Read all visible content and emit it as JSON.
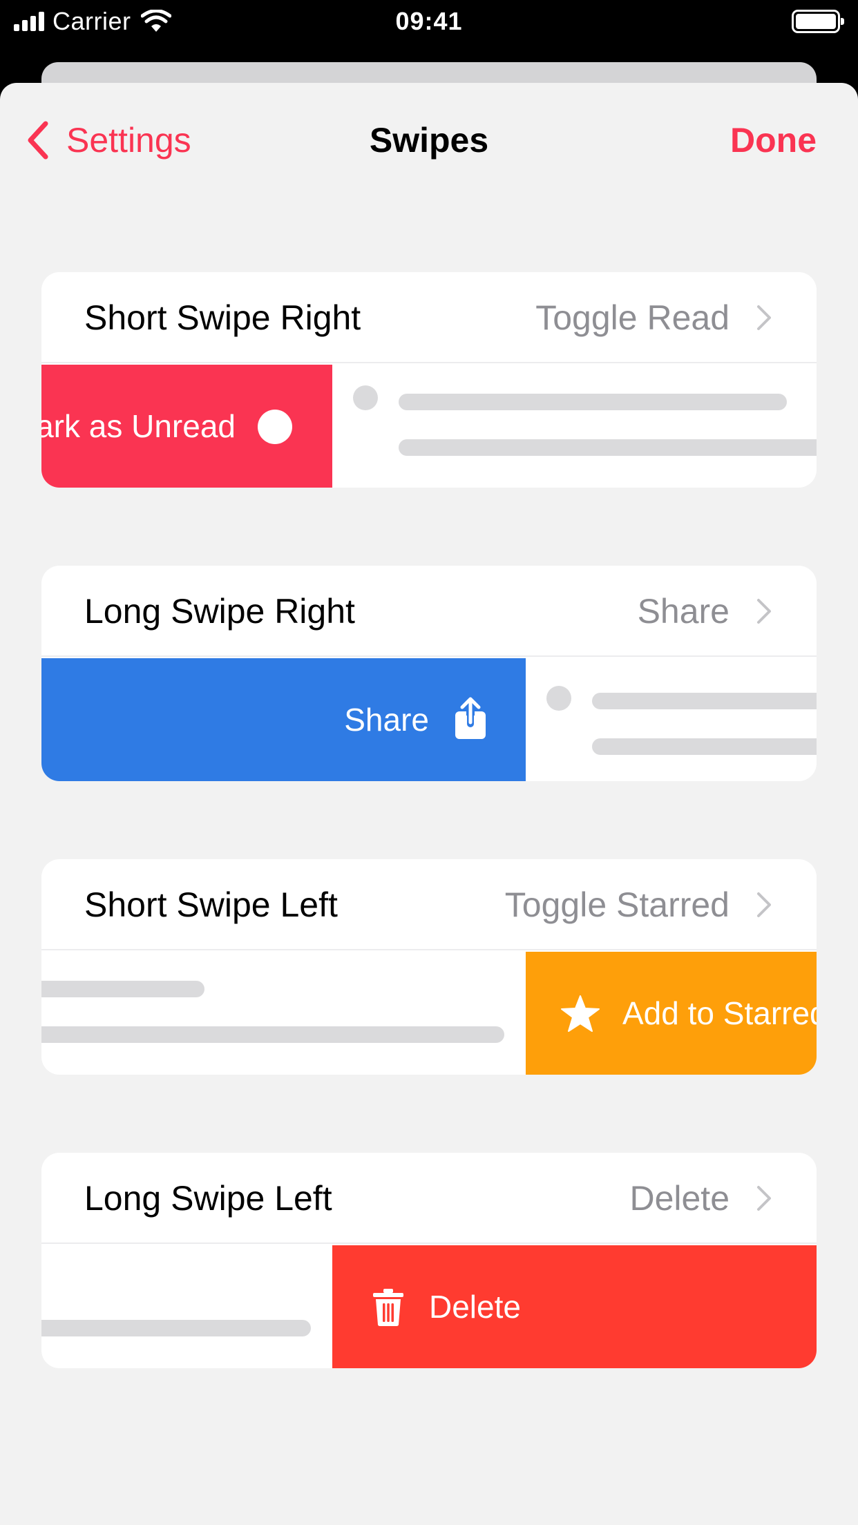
{
  "status_bar": {
    "carrier": "Carrier",
    "time": "09:41",
    "icons": [
      "signal-icon",
      "wifi-icon",
      "battery-icon"
    ]
  },
  "nav": {
    "back_label": "Settings",
    "title": "Swipes",
    "done_label": "Done",
    "icons": [
      "chevron-left-icon"
    ]
  },
  "sections": [
    {
      "label": "Short Swipe Right",
      "value": "Toggle Read",
      "preview_action": "Mark as Unread",
      "preview_icon": "unread-dot-icon",
      "color": "#fa3452"
    },
    {
      "label": "Long Swipe Right",
      "value": "Share",
      "preview_action": "Share",
      "preview_icon": "share-icon",
      "color": "#2f7be4"
    },
    {
      "label": "Short Swipe Left",
      "value": "Toggle Starred",
      "preview_action": "Add to Starred",
      "preview_icon": "star-icon",
      "color": "#fe9f0a"
    },
    {
      "label": "Long Swipe Left",
      "value": "Delete",
      "preview_action": "Delete",
      "preview_icon": "trash-icon",
      "color": "#ff3b30"
    }
  ],
  "colors": {
    "accent": "#fa3452",
    "background": "#f2f2f2",
    "secondary_text": "#8e8e93",
    "placeholder": "#dadadc"
  }
}
